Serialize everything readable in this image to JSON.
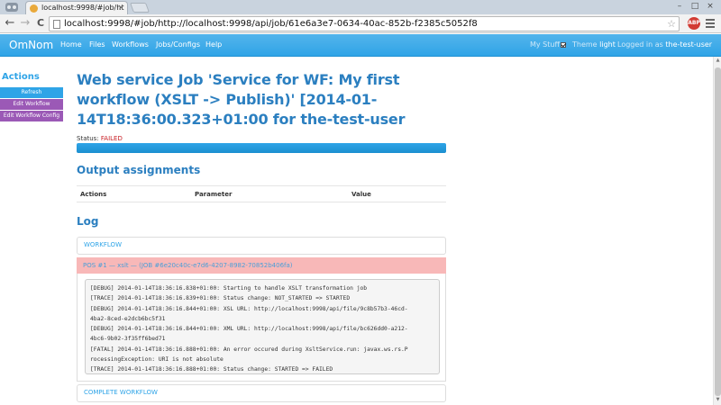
{
  "browser": {
    "tab_title": "localhost:9998/#job/ht",
    "tab_close": "×",
    "url": "localhost:9998/#job/http://localhost:9998/api/job/61e6a3e7-0634-40ac-852b-f2385c5052f8",
    "back": "←",
    "forward": "→",
    "reload": "C",
    "star": "☆",
    "abp_label": "ABP",
    "window_controls": [
      "–",
      "□",
      "×"
    ]
  },
  "navbar": {
    "brand": "OmNom",
    "items": [
      "Home",
      "Files",
      "Workflows",
      "Jobs/Configs",
      "Help"
    ],
    "my_stuff_label": "My Stuff",
    "theme_label": "Theme",
    "theme_value": "light",
    "logged_in_label": "Logged in as",
    "user": "the-test-user"
  },
  "sidebar": {
    "title": "Actions",
    "buttons": [
      "Refresh",
      "Edit Workflow",
      "Edit Workflow Config"
    ]
  },
  "job": {
    "title": "Web service Job 'Service for WF: My first workflow (XSLT -> Publish)' [2014-01-14T18:36:00.323+01:00 for the-test-user",
    "status_label": "Status:",
    "status_value": "FAILED",
    "progress": 1.0
  },
  "output": {
    "heading": "Output assignments",
    "columns": [
      "Actions",
      "Parameter",
      "Value"
    ]
  },
  "log": {
    "heading": "Log",
    "workflow_label": "WORKFLOW",
    "pos_label": "POS #1 — xslt — (JOB #6e20c40c-e7d6-4207-8982-70852b406fa)",
    "lines": [
      "[DEBUG] 2014-01-14T18:36:16.838+01:00: Starting to handle XSLT transformation job",
      "[TRACE] 2014-01-14T18:36:16.839+01:00: Status change: NOT_STARTED => STARTED",
      "[DEBUG] 2014-01-14T18:36:16.844+01:00: XSL URL: http://localhost:9998/api/file/9c8b57b3-46cd-",
      "4ba2-8ced-e2dcb6bc5f31",
      "[DEBUG] 2014-01-14T18:36:16.844+01:00: XML URL: http://localhost:9998/api/file/bc626dd0-a212-",
      "4bc6-9b02-3f35ff6bed71",
      "[FATAL] 2014-01-14T18:36:16.888+01:00: An error occured during XsltService.run: javax.ws.rs.P",
      "rocessingException: URI is not absolute",
      "[TRACE] 2014-01-14T18:36:16.888+01:00: Status change: STARTED => FAILED"
    ],
    "complete_label": "COMPLETE WORKFLOW"
  },
  "colors": {
    "accent": "#2fa4e7",
    "danger": "#c71c22",
    "purple": "#9b59b6",
    "pos_bg": "#f8b8b8"
  }
}
